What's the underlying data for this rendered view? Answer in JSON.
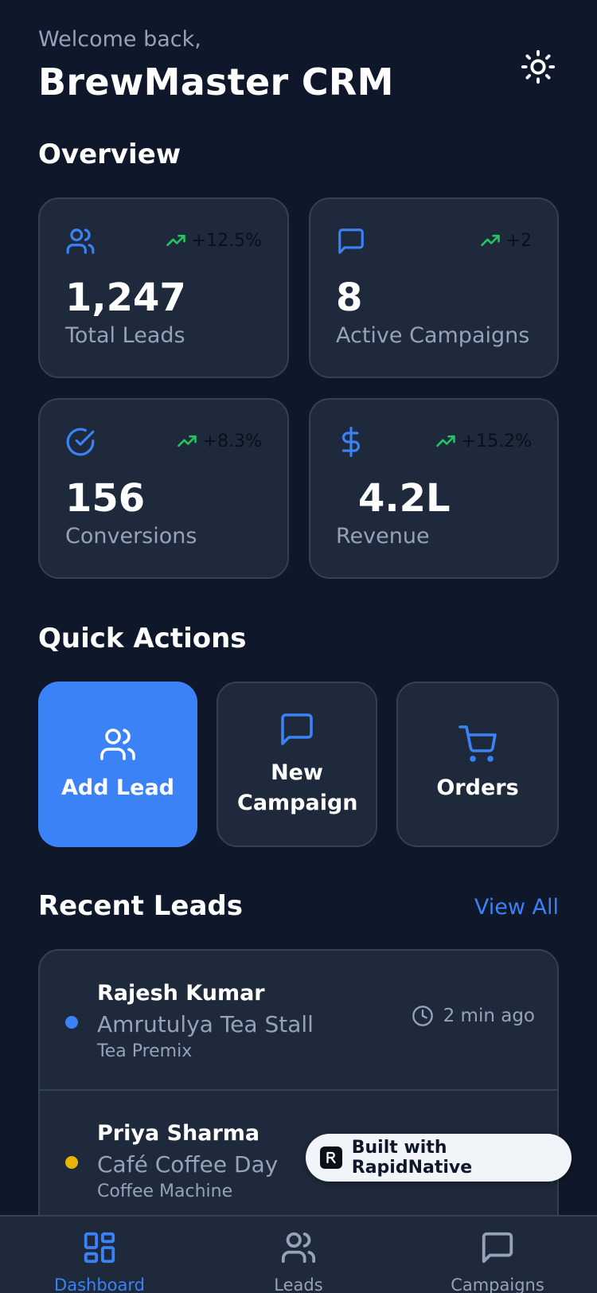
{
  "header": {
    "welcome": "Welcome back,",
    "title": "BrewMaster CRM"
  },
  "overview": {
    "title": "Overview",
    "cards": [
      {
        "icon": "users-icon",
        "value": "1,247",
        "label": "Total Leads",
        "trend": "+12.5%"
      },
      {
        "icon": "message-icon",
        "value": "8",
        "label": "Active Campaigns",
        "trend": "+2"
      },
      {
        "icon": "check-circle-icon",
        "value": "156",
        "label": "Conversions",
        "trend": "+8.3%"
      },
      {
        "icon": "dollar-icon",
        "value": "4.2L",
        "label": "Revenue",
        "trend": "+15.2%"
      }
    ]
  },
  "quick_actions": {
    "title": "Quick Actions",
    "items": [
      {
        "icon": "users-icon",
        "label": "Add Lead"
      },
      {
        "icon": "message-icon",
        "label": "New Campaign"
      },
      {
        "icon": "cart-icon",
        "label": "Orders"
      }
    ]
  },
  "recent_leads": {
    "title": "Recent Leads",
    "view_all": "View All",
    "items": [
      {
        "name": "Rajesh Kumar",
        "company": "Amrutulya Tea Stall",
        "product": "Tea Premix",
        "time": "2 min ago",
        "status_color": "#3b82f6"
      },
      {
        "name": "Priya Sharma",
        "company": "Café Coffee Day",
        "product": "Coffee Machine",
        "time": "",
        "status_color": "#eab308"
      }
    ]
  },
  "badge": {
    "text": "Built with RapidNative"
  },
  "nav": {
    "items": [
      {
        "icon": "dashboard-icon",
        "label": "Dashboard",
        "active": true
      },
      {
        "icon": "users-icon",
        "label": "Leads",
        "active": false
      },
      {
        "icon": "message-icon",
        "label": "Campaigns",
        "active": false
      }
    ]
  },
  "colors": {
    "background": "#0f172a",
    "card": "#1e293b",
    "border": "#334155",
    "accent": "#3b82f6",
    "trend_up": "#22c55e",
    "muted": "#94a3b8"
  }
}
